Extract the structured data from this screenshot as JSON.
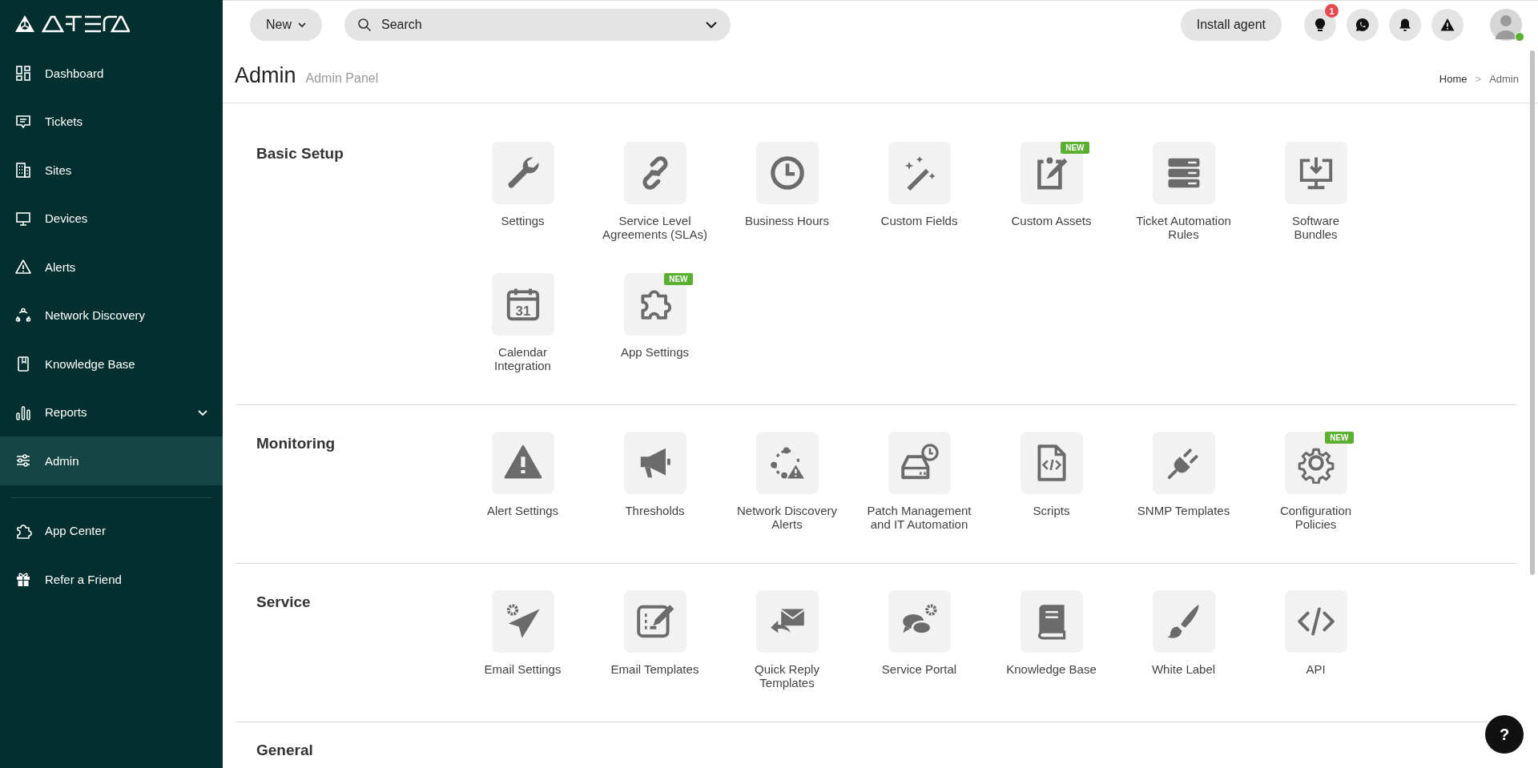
{
  "sidebar": {
    "items": [
      {
        "label": "Dashboard",
        "selected": false
      },
      {
        "label": "Tickets",
        "selected": false
      },
      {
        "label": "Sites",
        "selected": false
      },
      {
        "label": "Devices",
        "selected": false
      },
      {
        "label": "Alerts",
        "selected": false
      },
      {
        "label": "Network Discovery",
        "selected": false
      },
      {
        "label": "Knowledge Base",
        "selected": false
      },
      {
        "label": "Reports",
        "selected": false,
        "expanded": false
      },
      {
        "label": "Admin",
        "selected": true
      }
    ],
    "bottom_items": [
      {
        "label": "App Center",
        "selected": false
      },
      {
        "label": "Refer a Friend",
        "selected": false
      }
    ]
  },
  "top_bar": {
    "new_button": "New",
    "search": {
      "placeholder": "Search"
    },
    "install_button": "Install agent",
    "notification_badge": "1",
    "avatar_online": true
  },
  "page_header": {
    "title": "Admin",
    "subtitle": "Admin Panel",
    "breadcrumb": {
      "items": [
        "Home",
        "Admin"
      ],
      "separator": ">"
    }
  },
  "sections": [
    {
      "title": "Basic Setup",
      "items": [
        {
          "label": "Settings"
        },
        {
          "label": "Service Level\nAgreements (SLAs)"
        },
        {
          "label": "Business Hours"
        },
        {
          "label": "Custom Fields"
        },
        {
          "label": "Custom Assets",
          "badge": "NEW"
        },
        {
          "label": "Ticket Automation\nRules"
        },
        {
          "label": "Software\nBundles"
        },
        {
          "label": "Calendar\nIntegration",
          "icon_text": "31"
        },
        {
          "label": "App Settings",
          "badge": "NEW"
        }
      ]
    },
    {
      "title": "Monitoring",
      "items": [
        {
          "label": "Alert Settings"
        },
        {
          "label": "Thresholds"
        },
        {
          "label": "Network Discovery\nAlerts"
        },
        {
          "label": "Patch Management\nand IT Automation"
        },
        {
          "label": "Scripts"
        },
        {
          "label": "SNMP Templates"
        },
        {
          "label": "Configuration\nPolicies",
          "badge": "NEW"
        }
      ]
    },
    {
      "title": "Service",
      "items": [
        {
          "label": "Email Settings"
        },
        {
          "label": "Email Templates"
        },
        {
          "label": "Quick Reply\nTemplates"
        },
        {
          "label": "Service Portal"
        },
        {
          "label": "Knowledge Base"
        },
        {
          "label": "White Label"
        },
        {
          "label": "API"
        }
      ]
    },
    {
      "title": "General"
    }
  ],
  "help_button": "?"
}
